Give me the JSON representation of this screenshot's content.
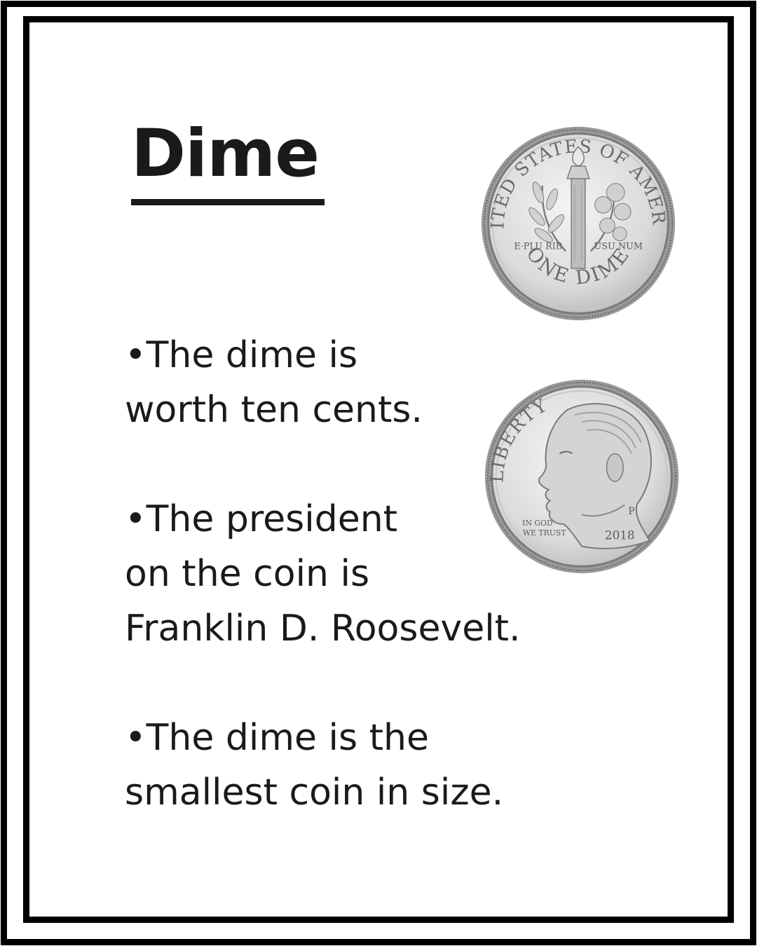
{
  "title": "Dime",
  "facts": [
    {
      "lines": [
        "•The dime is",
        "worth ten cents."
      ]
    },
    {
      "lines": [
        "•The president",
        "on the coin is",
        "Franklin D. Roosevelt."
      ]
    },
    {
      "lines": [
        "•The dime is the",
        "smallest coin in size."
      ]
    }
  ],
  "coins": {
    "reverse": {
      "top_text": "UNITED STATES OF AMERICA",
      "motto_left": "E·PLU RIB",
      "motto_right": "USU NUM",
      "bottom_text": "ONE DIME"
    },
    "obverse": {
      "top_text": "LIBERTY",
      "motto_line1": "IN GOD",
      "motto_line2": "WE TRUST",
      "year": "2018",
      "mint_mark": "P"
    }
  },
  "colors": {
    "text": "#1a1a1a",
    "border": "#000000",
    "coin_face": "#e4e4e4",
    "coin_rim": "#8a8a8a"
  }
}
